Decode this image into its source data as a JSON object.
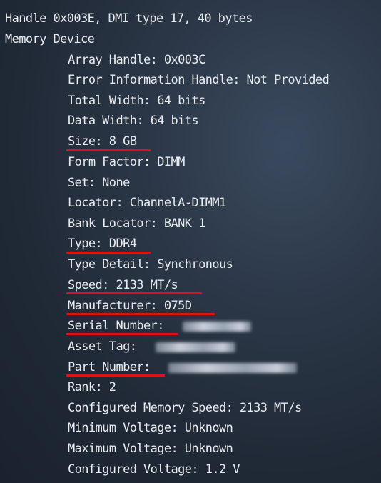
{
  "terminal": {
    "header": "Handle 0x003E, DMI type 17, 40 bytes",
    "section": "Memory Device",
    "fields": [
      "Array Handle: 0x003C",
      "Error Information Handle: Not Provided",
      "Total Width: 64 bits",
      "Data Width: 64 bits",
      "Size: 8 GB",
      "Form Factor: DIMM",
      "Set: None",
      "Locator: ChannelA-DIMM1",
      "Bank Locator: BANK 1",
      "Type: DDR4",
      "Type Detail: Synchronous",
      "Speed: 2133 MT/s",
      "Manufacturer: 075D",
      "Serial Number: ",
      "Asset Tag: ",
      "Part Number: ",
      "Rank: 2",
      "Configured Memory Speed: 2133 MT/s",
      "Minimum Voltage: Unknown",
      "Maximum Voltage: Unknown",
      "Configured Voltage: 1.2 V"
    ]
  },
  "highlight_color": "#e0101a"
}
